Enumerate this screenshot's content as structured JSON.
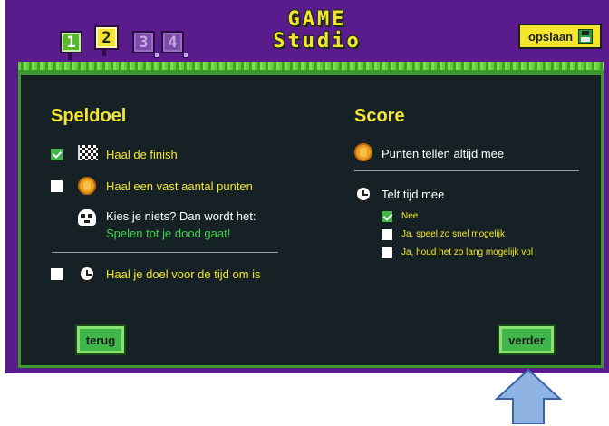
{
  "header": {
    "steps": [
      {
        "label": "1",
        "state": "done"
      },
      {
        "label": "2",
        "state": "current"
      },
      {
        "label": "3",
        "state": "todo"
      },
      {
        "label": "4",
        "state": "todo"
      }
    ],
    "logo": {
      "line1": "GAME",
      "line2": "Studio"
    },
    "save_label": "opslaan",
    "save_icon": "floppy-disk-icon"
  },
  "goal": {
    "title": "Speldoel",
    "options": [
      {
        "label": "Haal de finish",
        "checked": true,
        "icon": "checkered-flag-icon"
      },
      {
        "label": "Haal een vast aantal punten",
        "checked": false,
        "icon": "coin-icon"
      },
      {
        "label": "Haal je doel voor de tijd om is",
        "checked": false,
        "icon": "clock-icon"
      }
    ],
    "hint_line1": "Kies je niets? Dan wordt het:",
    "hint_line2": "Spelen tot je dood gaat!",
    "hint_icon": "skull-icon"
  },
  "score": {
    "title": "Score",
    "points_label": "Punten tellen altijd mee",
    "time_label": "Telt tijd mee",
    "time_options": [
      {
        "label": "Nee",
        "checked": true
      },
      {
        "label": "Ja, speel zo snel mogelijk",
        "checked": false
      },
      {
        "label": "Ja, houd het zo lang mogelijk vol",
        "checked": false
      }
    ]
  },
  "nav": {
    "back_label": "terug",
    "next_label": "verder"
  },
  "colors": {
    "accent": "#f4e62e",
    "green": "#3fb54a",
    "panel": "#152124",
    "purple": "#5a1b8c",
    "arrow": "#8fb4e3"
  }
}
